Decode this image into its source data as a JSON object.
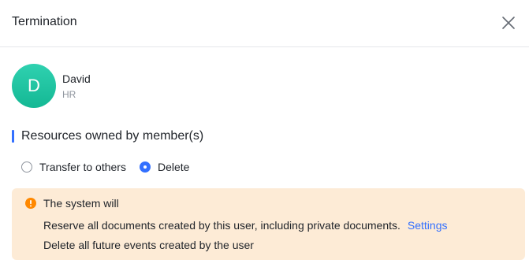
{
  "dialog": {
    "title": "Termination"
  },
  "user": {
    "avatar_initial": "D",
    "name": "David",
    "department": "HR"
  },
  "resources": {
    "section_title": "Resources owned by member(s)",
    "options": [
      {
        "label": "Transfer to others",
        "selected": false
      },
      {
        "label": "Delete",
        "selected": true
      }
    ]
  },
  "notice": {
    "title": "The system will",
    "line1": "Reserve all documents created by this user, including private documents.",
    "link_label": "Settings",
    "line2": "Delete all future events created by the user"
  },
  "icons": {
    "close": "close-icon",
    "warning": "warning-icon"
  },
  "colors": {
    "accent": "#3370ff",
    "avatar": "#1ec4a2",
    "notice_background": "#fdebd6",
    "warning": "#ff8800"
  }
}
